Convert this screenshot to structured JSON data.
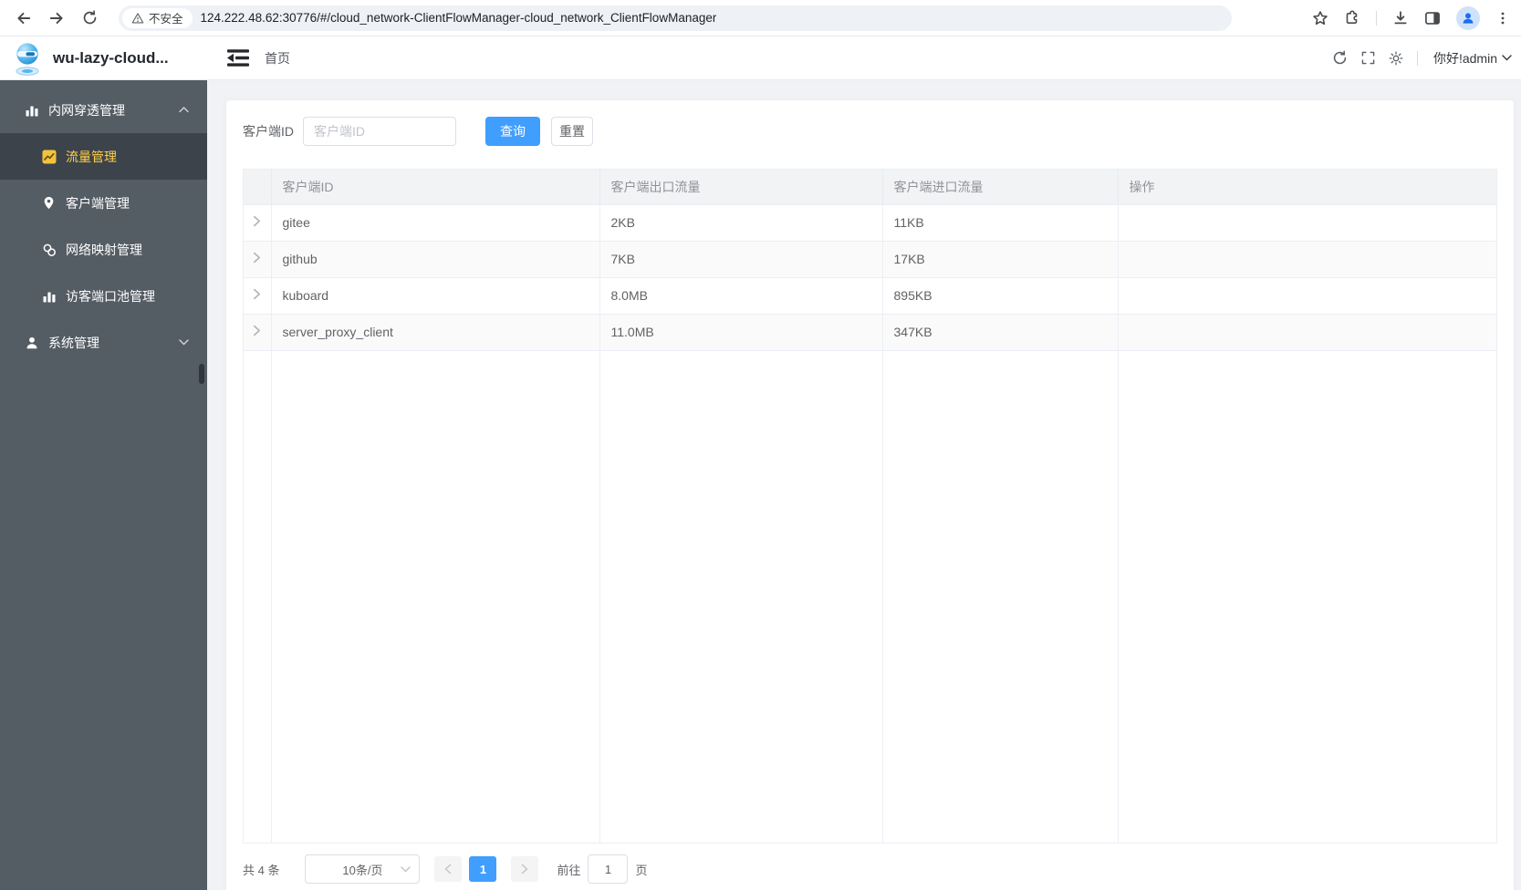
{
  "browser": {
    "security_label": "不安全",
    "url": "124.222.48.62:30776/#/cloud_network-ClientFlowManager-cloud_network_ClientFlowManager"
  },
  "header": {
    "app_title": "wu-lazy-cloud...",
    "breadcrumb": "首页",
    "greeting": "你好!admin"
  },
  "sidebar": {
    "groups": [
      {
        "label": "内网穿透管理",
        "expanded": true,
        "children": [
          {
            "label": "流量管理",
            "active": true
          },
          {
            "label": "客户端管理",
            "active": false
          },
          {
            "label": "网络映射管理",
            "active": false
          },
          {
            "label": "访客端口池管理",
            "active": false
          }
        ]
      },
      {
        "label": "系统管理",
        "expanded": false,
        "children": []
      }
    ]
  },
  "filter": {
    "label": "客户端ID",
    "placeholder": "客户端ID",
    "query_button": "查询",
    "reset_button": "重置"
  },
  "table": {
    "columns": [
      "客户端ID",
      "客户端出口流量",
      "客户端进口流量",
      "操作"
    ],
    "rows": [
      {
        "id": "gitee",
        "out": "2KB",
        "in": "11KB"
      },
      {
        "id": "github",
        "out": "7KB",
        "in": "17KB"
      },
      {
        "id": "kuboard",
        "out": "8.0MB",
        "in": "895KB"
      },
      {
        "id": "server_proxy_client",
        "out": "11.0MB",
        "in": "347KB"
      }
    ]
  },
  "pagination": {
    "total": "共 4 条",
    "page_size": "10条/页",
    "current_page": "1",
    "goto_label": "前往",
    "goto_value": "1",
    "page_unit": "页"
  },
  "colors": {
    "accent": "#409eff",
    "sidebar_bg": "#545c64",
    "sidebar_active_bg": "#3d434a",
    "active_text": "#ffd04b",
    "stripe": "#fafafa"
  }
}
